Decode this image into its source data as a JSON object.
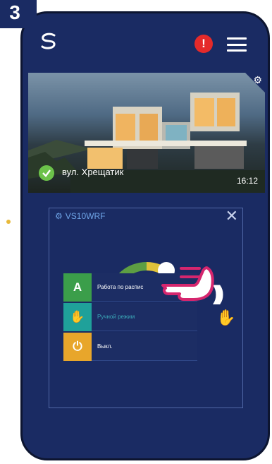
{
  "step": "3",
  "header": {
    "alert_symbol": "!"
  },
  "location": {
    "address": "вул. Хрещатик",
    "time": "16:12"
  },
  "device": {
    "name": "VS10WRF",
    "close_symbol": "✕"
  },
  "mode_menu": {
    "items": [
      {
        "icon_letter": "A",
        "label": "Работа по распис",
        "color": "#3b9e4a"
      },
      {
        "icon_letter": "✋",
        "label": "Ручной режим",
        "color": "#1fa19a",
        "current": true
      },
      {
        "icon_letter": "⏻",
        "label": "Выкл.",
        "color": "#e8a62b"
      }
    ]
  },
  "colors": {
    "background": "#1a2b63",
    "accent": "#6fa5e8",
    "alert": "#e52a2a",
    "ok": "#6cc24a"
  },
  "icons": [
    "logo-icon",
    "alert-icon",
    "menu-icon",
    "settings-icon",
    "check-icon",
    "gear-icon",
    "close-icon",
    "heat-icon",
    "hand-icon",
    "pointer-hand-icon"
  ]
}
